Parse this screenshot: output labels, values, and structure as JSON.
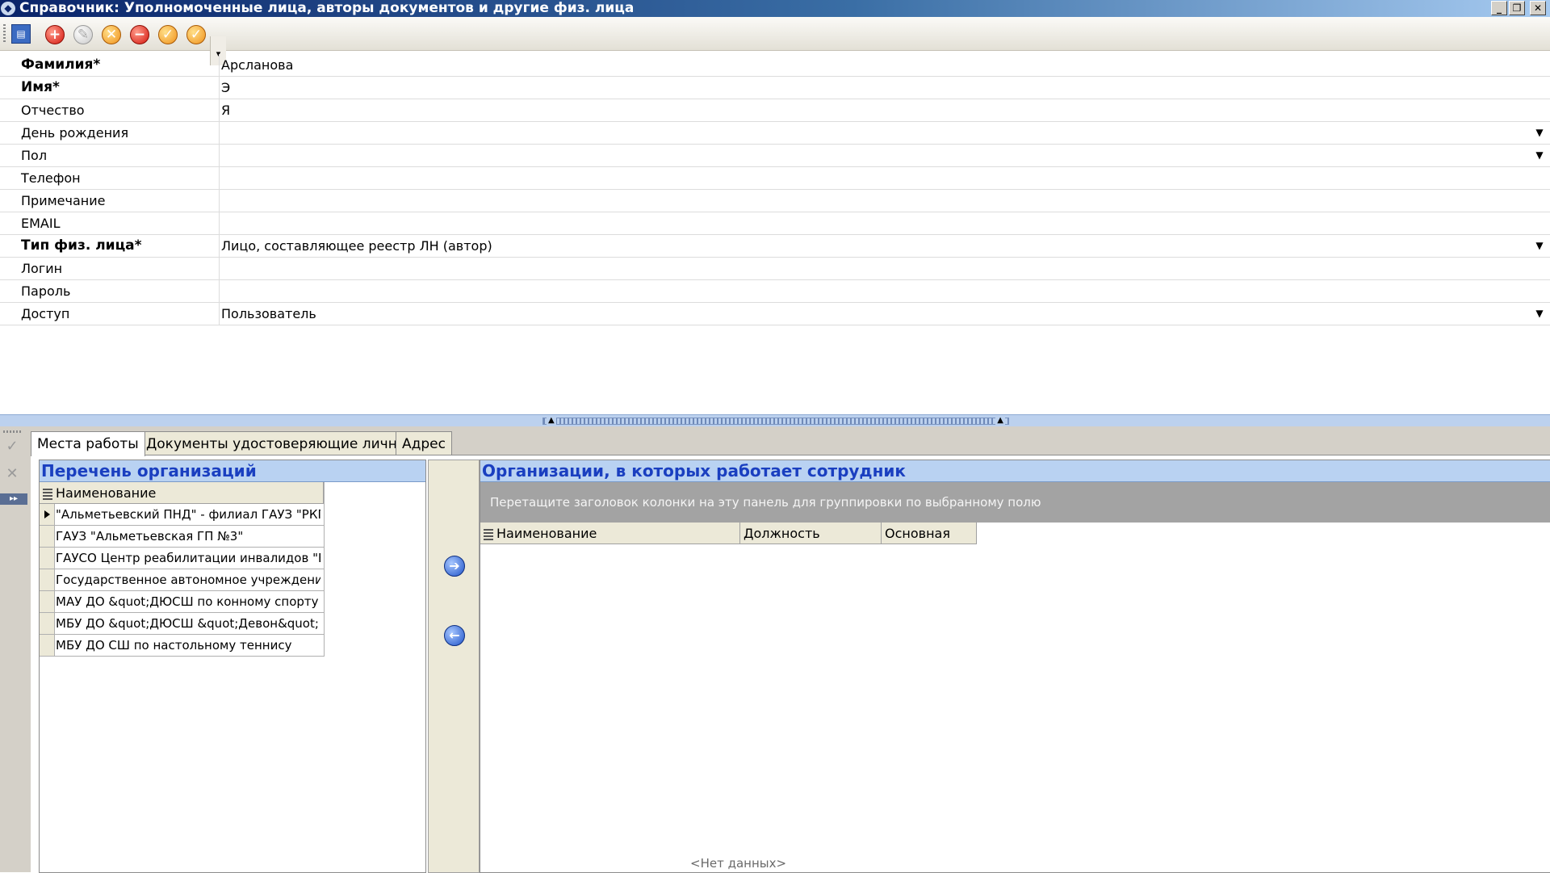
{
  "window": {
    "title": "Справочник: Уполномоченные лица, авторы документов и другие физ. лица",
    "controls": [
      "_",
      "❐",
      "✕"
    ]
  },
  "form": {
    "rows": [
      {
        "label": "Фамилия*",
        "value": "Арсланова",
        "bold": true,
        "dropdown": false
      },
      {
        "label": "Имя*",
        "value": "Э",
        "bold": true,
        "dropdown": false
      },
      {
        "label": "Отчество",
        "value": "Я",
        "bold": false,
        "dropdown": false
      },
      {
        "label": "День рождения",
        "value": "",
        "bold": false,
        "dropdown": true
      },
      {
        "label": "Пол",
        "value": "",
        "bold": false,
        "dropdown": true
      },
      {
        "label": "Телефон",
        "value": "",
        "bold": false,
        "dropdown": false
      },
      {
        "label": "Примечание",
        "value": "",
        "bold": false,
        "dropdown": false
      },
      {
        "label": "EMAIL",
        "value": "",
        "bold": false,
        "dropdown": false
      },
      {
        "label": "Тип физ. лица*",
        "value": "Лицо, составляющее реестр ЛН (автор)",
        "bold": true,
        "dropdown": true
      },
      {
        "label": "Логин",
        "value": "",
        "bold": false,
        "dropdown": false
      },
      {
        "label": "Пароль",
        "value": "",
        "bold": false,
        "dropdown": false
      },
      {
        "label": "Доступ",
        "value": "Пользователь",
        "bold": false,
        "dropdown": true
      }
    ]
  },
  "tabs": {
    "items": [
      "Места работы",
      "Документы удостоверяющие личность",
      "Адрес"
    ],
    "active": 0
  },
  "left_panel": {
    "title": "Перечень организаций",
    "column": "Наименование",
    "rows": [
      "\"Альметьевский ПНД\" - филиал ГАУЗ \"РКП",
      "ГАУЗ \"Альметьевская ГП №3\"",
      "ГАУСО Центр реабилитации инвалидов \"В",
      "Государственное автономное учреждение",
      "МАУ ДО &quot;ДЮСШ по конному спорту /",
      "МБУ ДО &quot;ДЮСШ &quot;Девон&quot;",
      "МБУ ДО СШ по настольному теннису"
    ],
    "current_row": 0
  },
  "right_panel": {
    "title": "Организации, в которых работает сотрудник",
    "group_hint": "Перетащите заголовок колонки на эту панель для группировки по выбранному полю",
    "columns": [
      "Наименование",
      "Должность",
      "Основная"
    ],
    "empty_text": "<Нет данных>"
  },
  "colors": {
    "panel_header_bg": "#b9d2f2",
    "panel_header_text": "#1a3fc0",
    "group_panel_bg": "#a3a3a3"
  }
}
